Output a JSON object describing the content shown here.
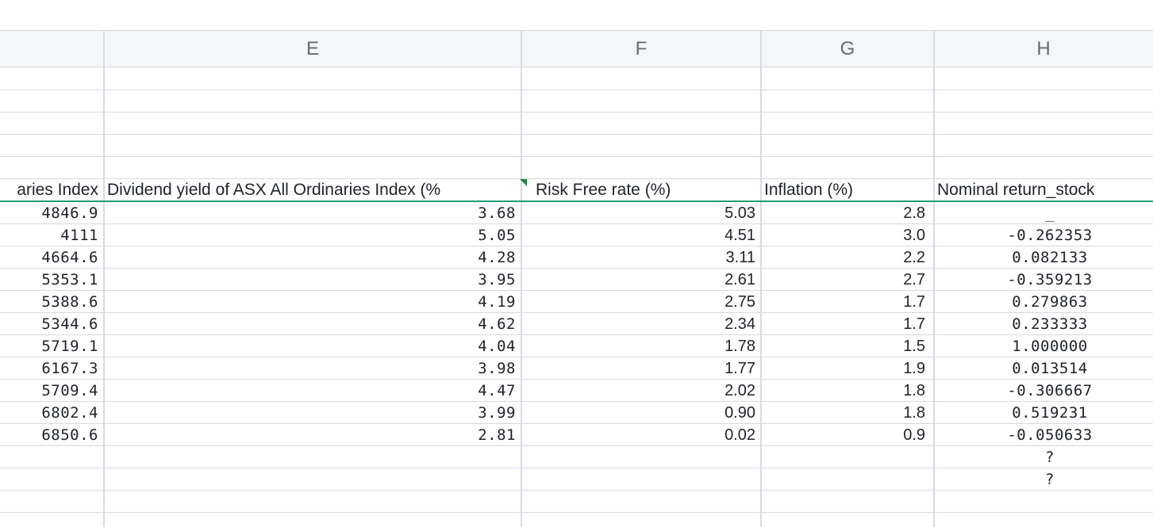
{
  "columns": [
    "E",
    "F",
    "G",
    "H"
  ],
  "headers": {
    "d": "aries Index",
    "e": "Dividend yield of ASX All Ordinaries Index (%",
    "f": "Risk Free rate (%)",
    "g": "Inflation (%)",
    "h": "Nominal return_stock"
  },
  "rows": [
    {
      "d": "4846.9",
      "e": "3.68",
      "f": "5.03",
      "g": "2.8",
      "h": "_"
    },
    {
      "d": "4111",
      "e": "5.05",
      "f": "4.51",
      "g": "3.0",
      "h": "-0.262353"
    },
    {
      "d": "4664.6",
      "e": "4.28",
      "f": "3.11",
      "g": "2.2",
      "h": "0.082133"
    },
    {
      "d": "5353.1",
      "e": "3.95",
      "f": "2.61",
      "g": "2.7",
      "h": "-0.359213"
    },
    {
      "d": "5388.6",
      "e": "4.19",
      "f": "2.75",
      "g": "1.7",
      "h": "0.279863"
    },
    {
      "d": "5344.6",
      "e": "4.62",
      "f": "2.34",
      "g": "1.7",
      "h": "0.233333"
    },
    {
      "d": "5719.1",
      "e": "4.04",
      "f": "1.78",
      "g": "1.5",
      "h": "1.000000"
    },
    {
      "d": "6167.3",
      "e": "3.98",
      "f": "1.77",
      "g": "1.9",
      "h": "0.013514"
    },
    {
      "d": "5709.4",
      "e": "4.47",
      "f": "2.02",
      "g": "1.8",
      "h": "-0.306667"
    },
    {
      "d": "6802.4",
      "e": "3.99",
      "f": "0.90",
      "g": "1.8",
      "h": "0.519231"
    },
    {
      "d": "6850.6",
      "e": "2.81",
      "f": "0.02",
      "g": "0.9",
      "h": "-0.050633"
    },
    {
      "d": "",
      "e": "",
      "f": "",
      "g": "",
      "h": "?"
    },
    {
      "d": "",
      "e": "",
      "f": "",
      "g": "",
      "h": "?"
    }
  ]
}
